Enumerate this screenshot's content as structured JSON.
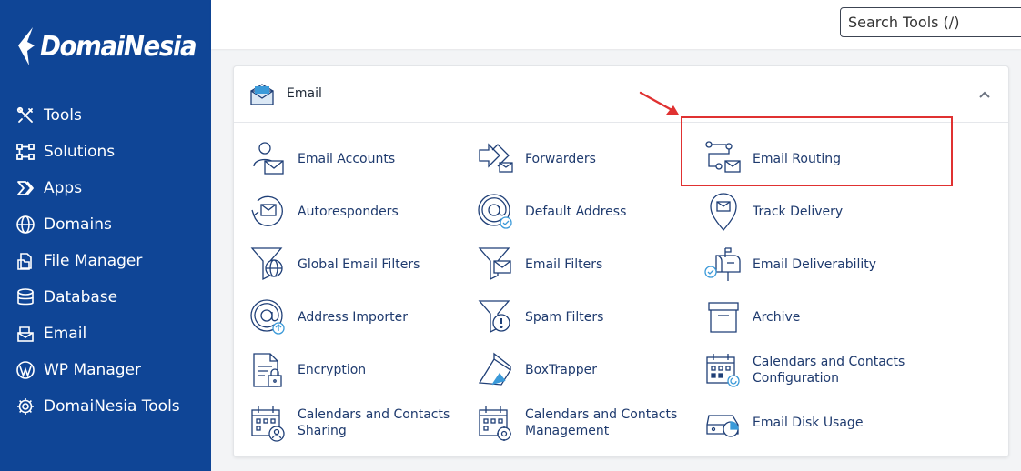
{
  "brand": {
    "name": "DomaiNesia"
  },
  "search": {
    "placeholder": "Search Tools (/)"
  },
  "nav": [
    {
      "label": "Tools",
      "icon": "tools-icon"
    },
    {
      "label": "Solutions",
      "icon": "solutions-icon"
    },
    {
      "label": "Apps",
      "icon": "apps-icon"
    },
    {
      "label": "Domains",
      "icon": "globe-icon"
    },
    {
      "label": "File Manager",
      "icon": "file-manager-icon"
    },
    {
      "label": "Database",
      "icon": "database-icon"
    },
    {
      "label": "Email",
      "icon": "email-icon"
    },
    {
      "label": "WP Manager",
      "icon": "wordpress-icon"
    },
    {
      "label": "DomaiNesia Tools",
      "icon": "gear-icon"
    }
  ],
  "section": {
    "title": "Email"
  },
  "tools": [
    {
      "label": "Email Accounts",
      "icon": "email-accounts-icon"
    },
    {
      "label": "Forwarders",
      "icon": "forwarders-icon"
    },
    {
      "label": "Email Routing",
      "icon": "email-routing-icon"
    },
    {
      "label": "Autoresponders",
      "icon": "autoresponders-icon"
    },
    {
      "label": "Default Address",
      "icon": "default-address-icon"
    },
    {
      "label": "Track Delivery",
      "icon": "track-delivery-icon"
    },
    {
      "label": "Global Email Filters",
      "icon": "global-filter-icon"
    },
    {
      "label": "Email Filters",
      "icon": "email-filter-icon"
    },
    {
      "label": "Email Deliverability",
      "icon": "mailbox-icon"
    },
    {
      "label": "Address Importer",
      "icon": "address-importer-icon"
    },
    {
      "label": "Spam Filters",
      "icon": "spam-filter-icon"
    },
    {
      "label": "Archive",
      "icon": "archive-icon"
    },
    {
      "label": "Encryption",
      "icon": "encryption-icon"
    },
    {
      "label": "BoxTrapper",
      "icon": "boxtrapper-icon"
    },
    {
      "label": "Calendars and Contacts Configuration",
      "icon": "calendar-config-icon"
    },
    {
      "label": "Calendars and Contacts Sharing",
      "icon": "calendar-sharing-icon"
    },
    {
      "label": "Calendars and Contacts Management",
      "icon": "calendar-management-icon"
    },
    {
      "label": "Email Disk Usage",
      "icon": "disk-usage-icon"
    }
  ],
  "colors": {
    "sidebar": "#0f4596",
    "link": "#1e3a6e",
    "icon": "#1f3f77",
    "accent": "#3b9ad9",
    "highlight": "#e03131"
  }
}
